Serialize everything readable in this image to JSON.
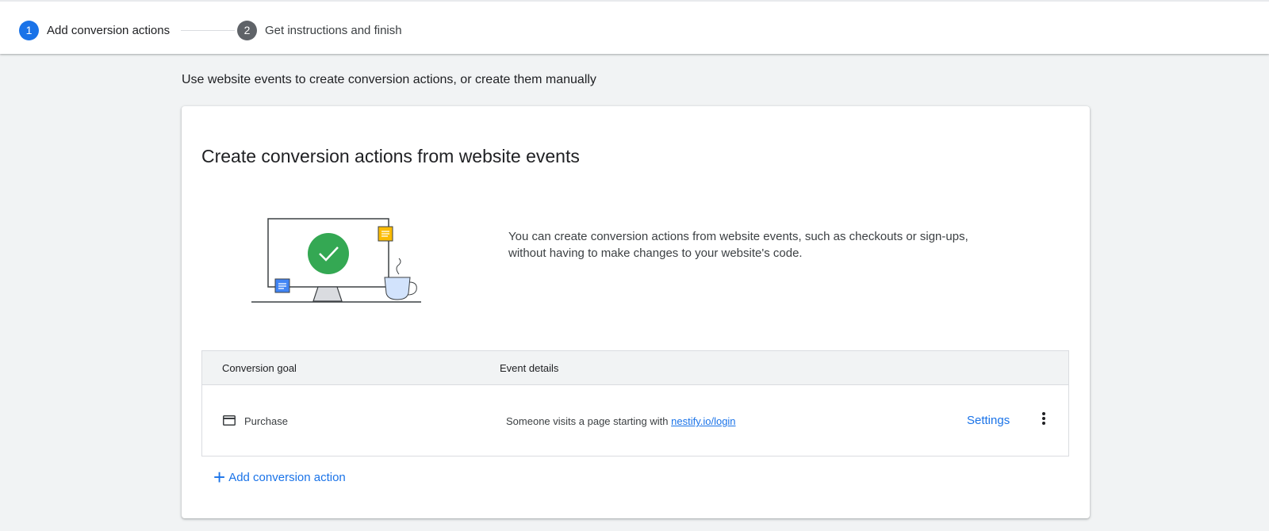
{
  "stepper": {
    "steps": [
      {
        "number": "1",
        "label": "Add conversion actions",
        "state": "active"
      },
      {
        "number": "2",
        "label": "Get instructions and finish",
        "state": "inactive"
      }
    ]
  },
  "intro_text": "Use website events to create conversion actions, or create them manually",
  "card": {
    "title": "Create conversion actions from website events",
    "description": "You can create conversion actions from website events, such as checkouts or sign-ups, without having to make changes to your website's code.",
    "table": {
      "headers": [
        "Conversion goal",
        "Event details"
      ],
      "rows": [
        {
          "goal_icon": "credit-card-icon",
          "goal": "Purchase",
          "event_prefix": "Someone visits a page starting with",
          "event_link": "nestify.io/login",
          "settings_label": "Settings",
          "menu_icon": "more-vert-icon"
        }
      ]
    },
    "add_action_label": "Add conversion action"
  },
  "colors": {
    "accent": "#1a73e8",
    "check_green": "#34a853",
    "note_yellow": "#fbbc04",
    "note_blue": "#4285f4"
  }
}
